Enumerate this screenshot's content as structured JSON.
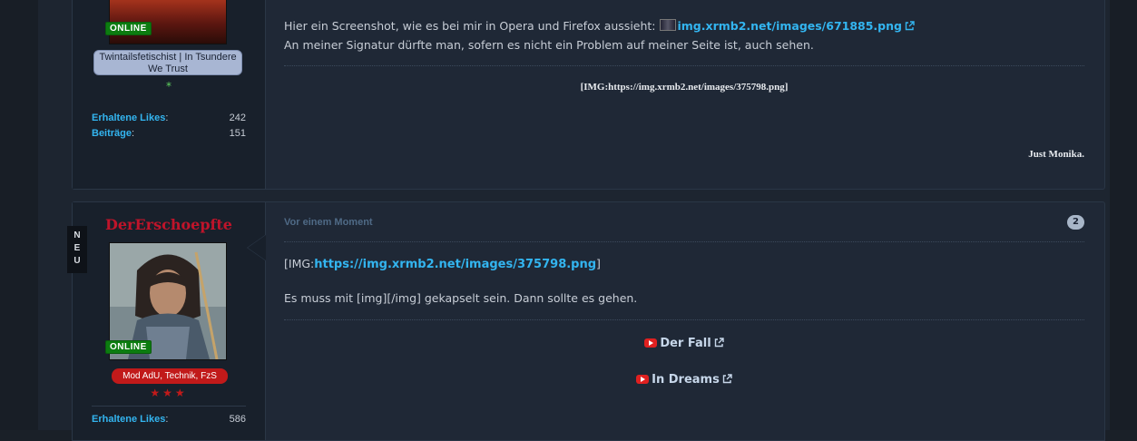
{
  "post1": {
    "online_label": "ONLINE",
    "user_title": "Twintailsfetischist | In Tsundere We Trust",
    "star_glyph": "*",
    "stats": [
      {
        "label": "Erhaltene Likes",
        "value": "242"
      },
      {
        "label": "Beiträge",
        "value": "151"
      }
    ],
    "message": {
      "line1_text": "Hier ein Screenshot, wie es bei mir in Opera und Firefox aussieht:",
      "line1_link": "img.xrmb2.net/images/671885.png",
      "line2_text": "An meiner Signatur dürfte man, sofern es nicht ein Problem auf meiner Seite ist, auch sehen."
    },
    "signature": {
      "img_code": "[IMG:https://img.xrmb2.net/images/375798.png]",
      "closing": "Just Monika."
    }
  },
  "post2": {
    "new_tag": [
      "N",
      "E",
      "U"
    ],
    "username": "DerErschoepfte",
    "online_label": "ONLINE",
    "rank_label": "Mod AdU, Technik, FzS",
    "stars": "★★★",
    "stats": [
      {
        "label": "Erhaltene Likes",
        "value": "586"
      }
    ],
    "meta_time": "Vor einem Moment",
    "post_number": "2",
    "message": {
      "img_prefix": "[IMG:",
      "img_link": "https://img.xrmb2.net/images/375798.png",
      "img_suffix": "]",
      "line2": "Es muss mit [img][/img] gekapselt sein. Dann sollte es gehen."
    },
    "signature": {
      "video1": "Der Fall",
      "video2": "In Dreams"
    }
  },
  "colors": {
    "accent_link": "#33b5f0",
    "username_red": "#c0142a",
    "online_green": "#0c7c10",
    "youtube_red": "#e02020"
  }
}
